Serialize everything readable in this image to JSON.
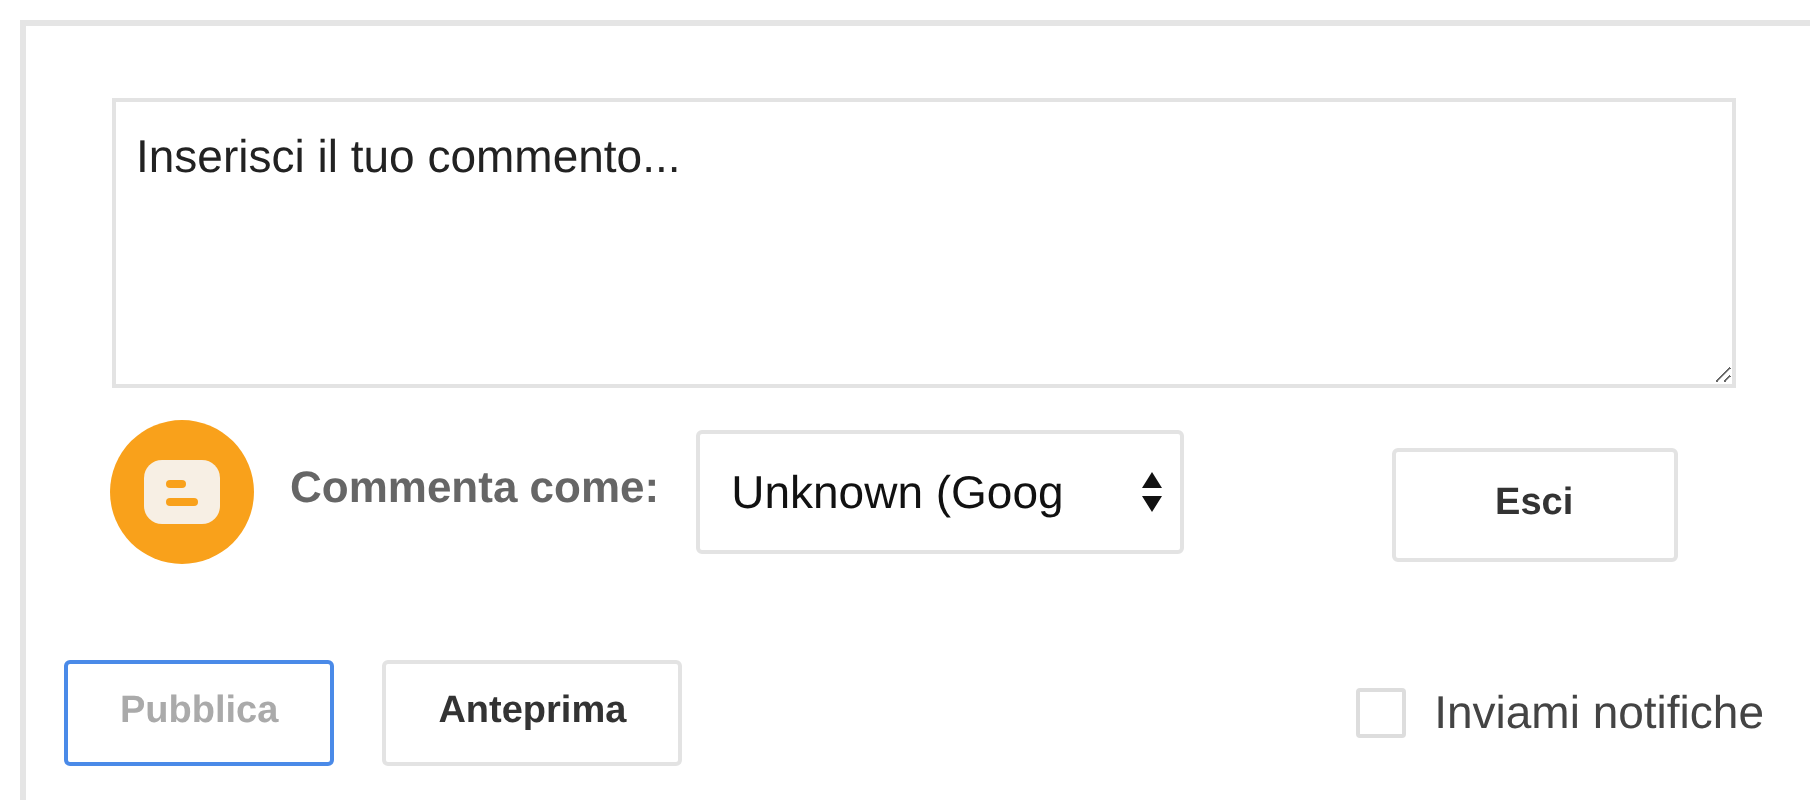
{
  "comment_box": {
    "placeholder": "Inserisci il tuo commento..."
  },
  "identity": {
    "label": "Commenta come:",
    "value": "Unknown (Goog"
  },
  "logout_button": {
    "label": "Esci"
  },
  "actions": [
    {
      "label": "Pubblica",
      "disabled": true,
      "focused": true
    },
    {
      "label": "Anteprima",
      "disabled": false,
      "focused": false
    }
  ],
  "notify": {
    "label": "Inviami notifiche",
    "checked": false
  }
}
